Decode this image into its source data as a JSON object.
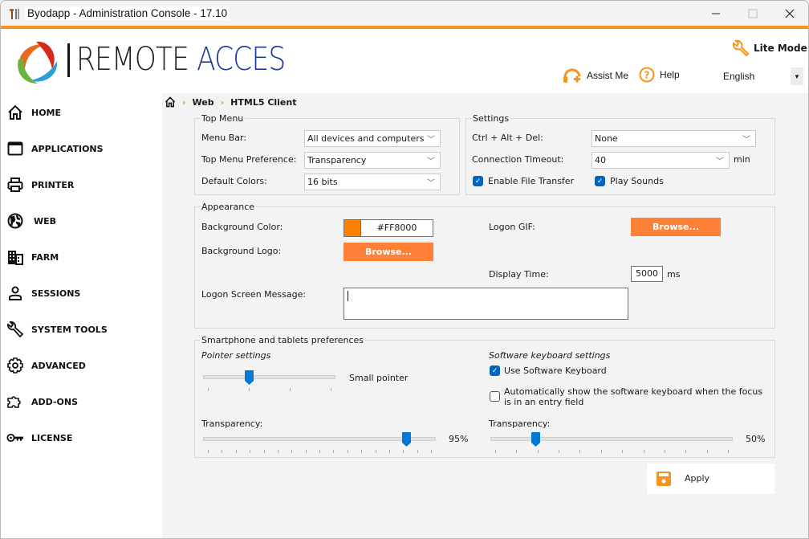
{
  "window": {
    "title": "Byodapp - Administration Console - 17.10",
    "controls": [
      "minimize",
      "maximize",
      "close"
    ]
  },
  "header": {
    "logo_text_dark": "REMOTE",
    "logo_text_blue": "ACCES",
    "lite_mode": "Lite Mode",
    "assist_me": "Assist Me",
    "help": "Help",
    "language": "English"
  },
  "sidebar": {
    "items": [
      {
        "label": "HOME",
        "icon": "home-icon"
      },
      {
        "label": "APPLICATIONS",
        "icon": "window-icon"
      },
      {
        "label": "PRINTER",
        "icon": "printer-icon"
      },
      {
        "label": "WEB",
        "icon": "globe-icon"
      },
      {
        "label": "FARM",
        "icon": "building-icon"
      },
      {
        "label": "SESSIONS",
        "icon": "user-icon"
      },
      {
        "label": "SYSTEM TOOLS",
        "icon": "wrench-icon"
      },
      {
        "label": "ADVANCED",
        "icon": "gear-icon"
      },
      {
        "label": "ADD-ONS",
        "icon": "puzzle-icon"
      },
      {
        "label": "LICENSE",
        "icon": "key-icon"
      }
    ]
  },
  "breadcrumb": {
    "items": [
      "Web",
      "HTML5 Client"
    ]
  },
  "top_menu": {
    "legend": "Top Menu",
    "menu_bar_label": "Menu Bar:",
    "menu_bar_value": "All devices and computers",
    "preference_label": "Top Menu Preference:",
    "preference_value": "Transparency",
    "colors_label": "Default Colors:",
    "colors_value": "16 bits"
  },
  "settings": {
    "legend": "Settings",
    "cad_label": "Ctrl + Alt + Del:",
    "cad_value": "None",
    "timeout_label": "Connection Timeout:",
    "timeout_value": "40",
    "timeout_unit": "min",
    "file_transfer_label": "Enable File Transfer",
    "file_transfer_checked": true,
    "play_sounds_label": "Play Sounds",
    "play_sounds_checked": true
  },
  "appearance": {
    "legend": "Appearance",
    "bg_color_label": "Background Color:",
    "bg_color_value": "#FF8000",
    "bg_logo_label": "Background Logo:",
    "browse_label": "Browse...",
    "logon_gif_label": "Logon GIF:",
    "display_time_label": "Display Time:",
    "display_time_value": "5000",
    "display_time_unit": "ms",
    "logon_message_label": "Logon Screen Message:",
    "logon_message_value": ""
  },
  "smartphone": {
    "legend": "Smartphone and tablets preferences",
    "pointer_heading": "Pointer settings",
    "pointer_size_label": "Small pointer",
    "pointer_size_position": 1,
    "pointer_size_max": 3,
    "pointer_transparency_label": "Transparency:",
    "pointer_transparency_value": "95%",
    "pointer_transparency_pct": 95,
    "keyboard_heading": "Software keyboard settings",
    "use_keyboard_label": "Use Software Keyboard",
    "use_keyboard_checked": true,
    "auto_show_label": "Automatically show the software keyboard when the focus is in an entry field",
    "auto_show_checked": false,
    "keyboard_transparency_label": "Transparency:",
    "keyboard_transparency_value": "50%",
    "keyboard_transparency_pct": 50
  },
  "actions": {
    "apply_label": "Apply"
  },
  "colors": {
    "accent_orange": "#F7931E",
    "button_orange": "#FF8138",
    "slider_blue": "#0078D4",
    "swatch": "#FF8000"
  }
}
